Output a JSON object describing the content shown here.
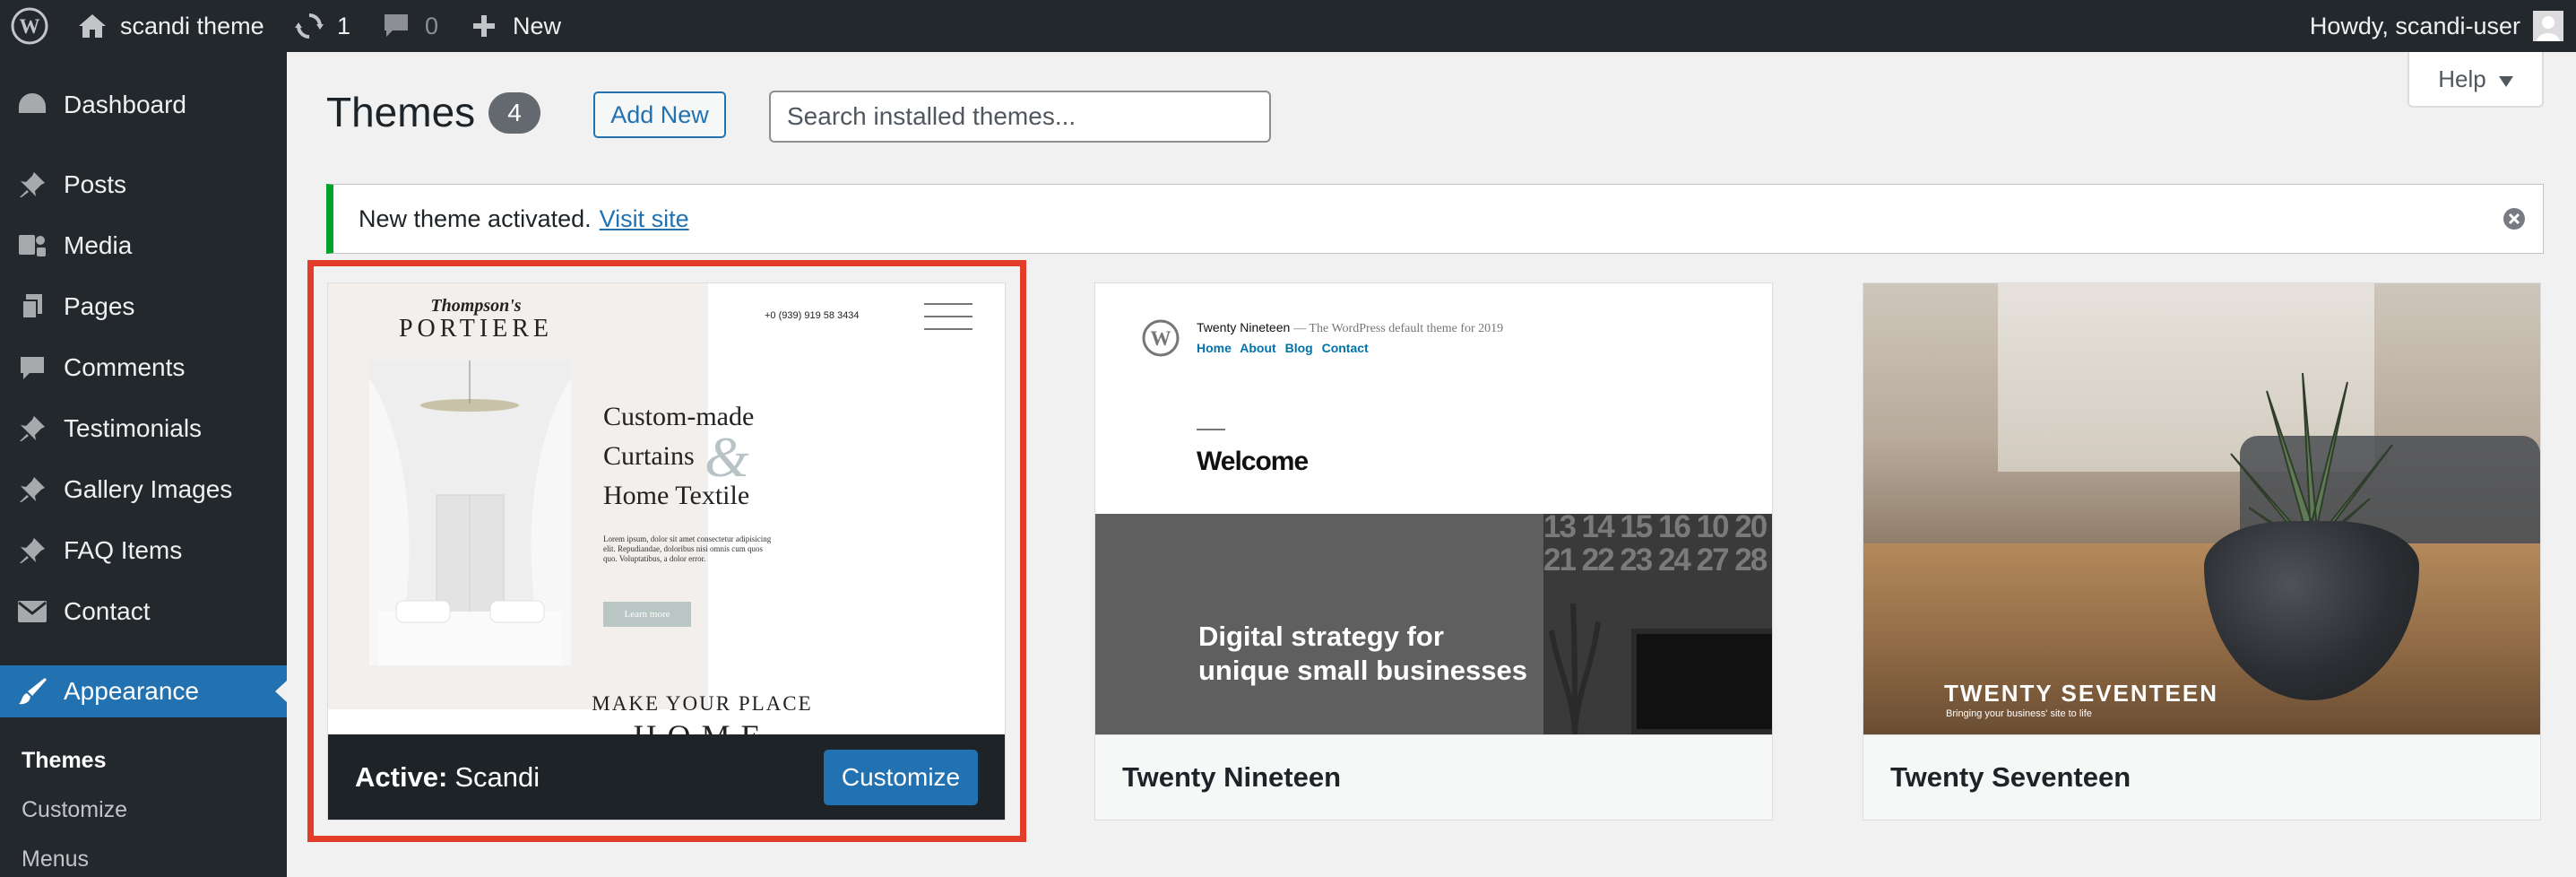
{
  "adminbar": {
    "site_name": "scandi theme",
    "updates_count": "1",
    "comments_count": "0",
    "new_label": "New",
    "howdy": "Howdy, scandi-user"
  },
  "sidebar": {
    "items": [
      {
        "label": "Dashboard",
        "icon": "dashboard-icon"
      },
      {
        "label": "Posts",
        "icon": "pin-icon"
      },
      {
        "label": "Media",
        "icon": "media-icon"
      },
      {
        "label": "Pages",
        "icon": "pages-icon"
      },
      {
        "label": "Comments",
        "icon": "comment-icon"
      },
      {
        "label": "Testimonials",
        "icon": "pin-icon"
      },
      {
        "label": "Gallery Images",
        "icon": "pin-icon"
      },
      {
        "label": "FAQ Items",
        "icon": "pin-icon"
      },
      {
        "label": "Contact",
        "icon": "envelope-icon"
      },
      {
        "label": "Appearance",
        "icon": "paintbrush-icon"
      }
    ],
    "submenu": [
      "Themes",
      "Customize",
      "Menus"
    ]
  },
  "header": {
    "title": "Themes",
    "count": "4",
    "add_new": "Add New",
    "search_placeholder": "Search installed themes...",
    "help": "Help"
  },
  "notice": {
    "text": "New theme activated.",
    "link": "Visit site"
  },
  "themes": {
    "active": {
      "prefix": "Active:",
      "name": "Scandi",
      "customize": "Customize",
      "preview": {
        "logo_script": "Thompson's",
        "logo_main": "PORTIERE",
        "phone": "+0 (939) 919 58 3434",
        "headline_1": "Custom-made",
        "headline_2": "Curtains",
        "amp": "&",
        "headline_3": "Home Textile",
        "lorem": "Lorem ipsum, dolor sit amet consectetur adipisicing elit. Repudiandae, doloribus nisi omnis cum quos quo. Voluptatibus, a dolor error.",
        "learn_more": "Learn more",
        "make": "MAKE YOUR PLACE",
        "home": "HOME"
      }
    },
    "nineteen": {
      "name": "Twenty Nineteen",
      "preview": {
        "site_title": "Twenty Nineteen",
        "site_desc": "— The WordPress default theme for 2019",
        "nav": "Home About Blog Contact",
        "welcome": "Welcome",
        "hero_1": "Digital strategy for",
        "hero_2": "unique small businesses",
        "calendar": "13 14 15 16 10 20 21 22 23 24 27 28"
      }
    },
    "seventeen": {
      "name": "Twenty Seventeen",
      "preview": {
        "title": "TWENTY SEVENTEEN",
        "tagline": "Bringing your business' site to life"
      }
    }
  },
  "colors": {
    "adminbar_bg": "#23282d",
    "accent": "#2271b1",
    "highlight": "#e33d2a",
    "notice_success": "#00a32a"
  }
}
